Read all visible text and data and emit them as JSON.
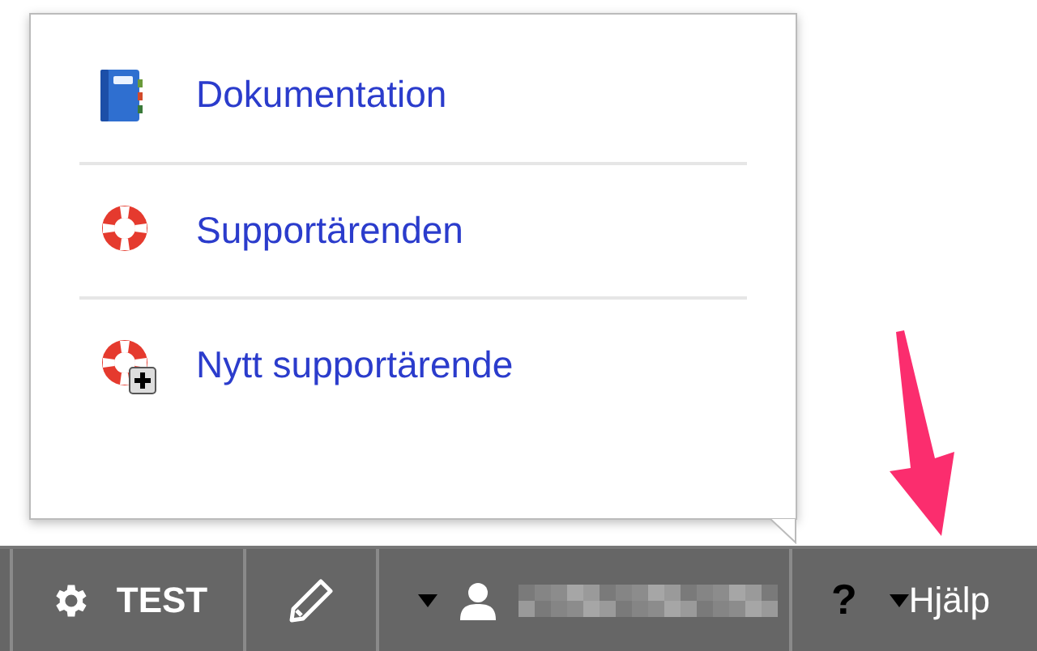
{
  "help_menu": {
    "items": [
      {
        "kind": "book",
        "label": "Dokumentation"
      },
      {
        "kind": "lifebuoy",
        "label": "Supportärenden"
      },
      {
        "kind": "lifebuoy-plus",
        "label": "Nytt supportärende"
      }
    ]
  },
  "toolbar": {
    "items": [
      {
        "kind": "settings",
        "label": "TEST"
      },
      {
        "kind": "edit"
      },
      {
        "kind": "user",
        "dropdown": true
      },
      {
        "kind": "help",
        "glyph": "?",
        "dropdown": true,
        "label": "Hjälp"
      }
    ]
  }
}
